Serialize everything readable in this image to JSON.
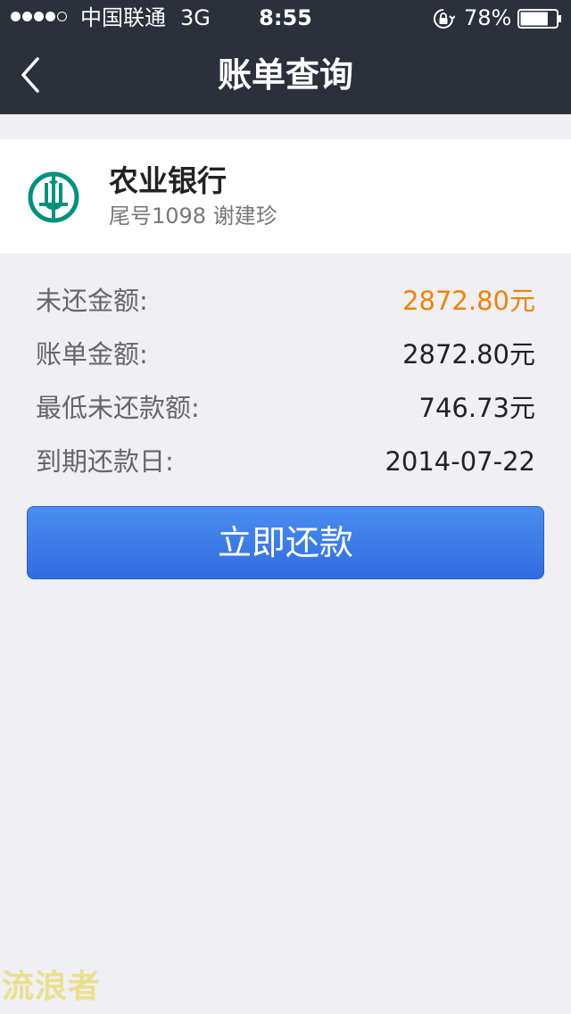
{
  "status_bar": {
    "carrier": "中国联通",
    "network": "3G",
    "time": "8:55",
    "battery_percent": "78%",
    "battery_level": 0.78,
    "signal_bars_filled": 4,
    "signal_bars_total": 5
  },
  "nav": {
    "title": "账单查询",
    "back_icon": "chevron-left-icon"
  },
  "bank": {
    "name": "农业银行",
    "account_info": "尾号1098 谢建珍",
    "logo_icon": "abc-bank-logo",
    "logo_color": "#00927c"
  },
  "details": [
    {
      "label": "未还金额:",
      "value": "2872.80元",
      "highlight": true
    },
    {
      "label": "账单金额:",
      "value": "2872.80元",
      "highlight": false
    },
    {
      "label": "最低未还款额:",
      "value": "746.73元",
      "highlight": false
    },
    {
      "label": "到期还款日:",
      "value": "2014-07-22",
      "highlight": false
    }
  ],
  "pay_button": {
    "label": "立即还款"
  },
  "watermark": {
    "text": "流浪者"
  },
  "colors": {
    "nav_background": "#2c303a",
    "page_background": "#efeff4",
    "highlight_amount": "#f08300",
    "button_blue": "#3a7ae8"
  }
}
